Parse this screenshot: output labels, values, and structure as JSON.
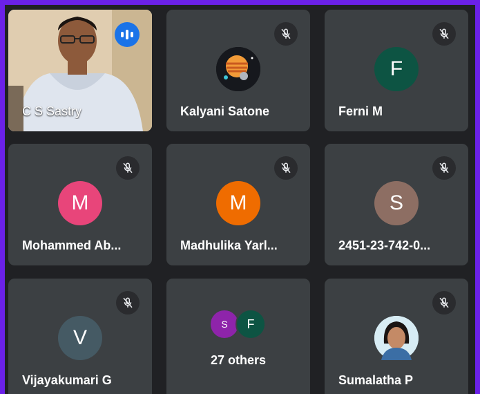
{
  "participants": [
    {
      "name": "C S Sastry",
      "status": "speaking",
      "has_video": true
    },
    {
      "name": "Kalyani Satone",
      "muted": true,
      "avatar": "planet-image"
    },
    {
      "name": "Ferni M",
      "muted": true,
      "initial": "F",
      "color": "#0d5443"
    },
    {
      "name": "Mohammed Ab...",
      "muted": true,
      "initial": "M",
      "color": "#e8457a"
    },
    {
      "name": "Madhulika Yarl...",
      "muted": true,
      "initial": "M",
      "color": "#ef6c00"
    },
    {
      "name": "2451-23-742-0...",
      "muted": true,
      "initial": "S",
      "color": "#8d6e63"
    },
    {
      "name": "Vijayakumari G",
      "muted": true,
      "initial": "V",
      "color": "#455a64"
    },
    {
      "name": "Sumalatha P",
      "muted": true,
      "avatar": "photo"
    }
  ],
  "others": {
    "label": "27 others",
    "avatars": [
      {
        "initial": "S",
        "color": "#8e24aa"
      },
      {
        "initial": "F",
        "color": "#0d5443"
      }
    ]
  },
  "icons": {
    "muted": "mic-off-icon",
    "speaking": "audio-level-icon"
  }
}
